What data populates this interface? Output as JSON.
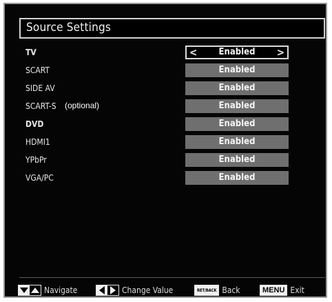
{
  "title": "Source Settings",
  "sources": [
    {
      "name": "TV",
      "value": "Enabled",
      "selected": true,
      "bold": true
    },
    {
      "name": "SCART",
      "value": "Enabled",
      "selected": false,
      "bold": false
    },
    {
      "name": "SIDE AV",
      "value": "Enabled",
      "selected": false,
      "bold": false
    },
    {
      "name": "SCART-S",
      "note": "(optional)",
      "value": "Enabled",
      "selected": false,
      "bold": false
    },
    {
      "name": "DVD",
      "value": "Enabled",
      "selected": false,
      "bold": true
    },
    {
      "name": "HDMI1",
      "value": "Enabled",
      "selected": false,
      "bold": false
    },
    {
      "name": "YPbPr",
      "value": "Enabled",
      "selected": false,
      "bold": false
    },
    {
      "name": "VGA/PC",
      "value": "Enabled",
      "selected": false,
      "bold": false
    }
  ],
  "footer": {
    "navigate": "Navigate",
    "change_value": "Change Value",
    "ret_key": "RET/BACK",
    "back": "Back",
    "menu_key": "MENU",
    "exit": "Exit"
  },
  "colors": {
    "background": "#050505",
    "value_bar": "#6f6f6f",
    "frame_border": "#9a9a9a",
    "text": "#f2f2f2"
  },
  "icons": {
    "left": "chevron-left-icon",
    "right": "chevron-right-icon",
    "up": "triangle-up-icon",
    "down": "triangle-down-icon"
  }
}
